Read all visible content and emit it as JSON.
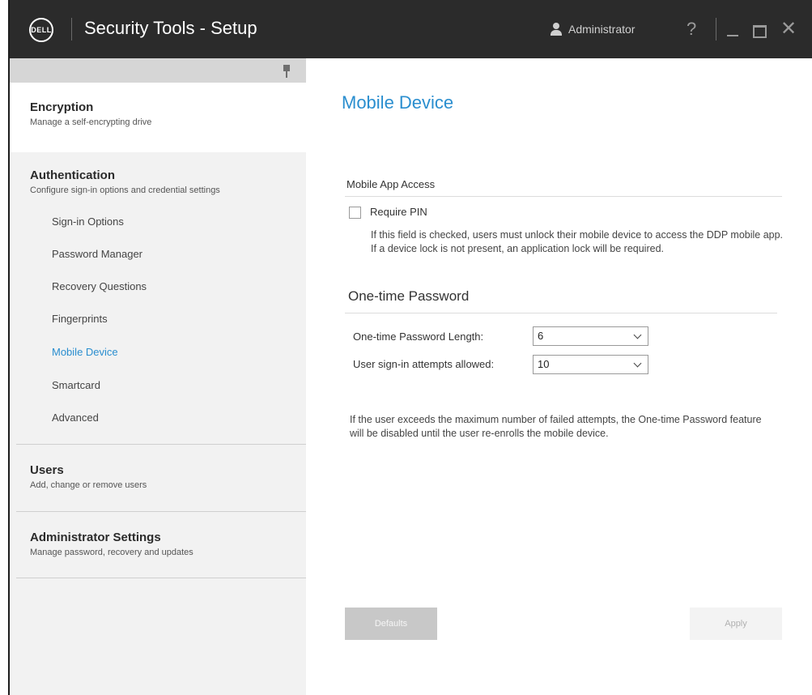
{
  "titlebar": {
    "logo_text": "DELL",
    "app_title": "Security Tools - Setup",
    "user_label": "Administrator",
    "help_glyph": "?",
    "close_glyph": "✕"
  },
  "sidebar": {
    "sections": [
      {
        "title": "Encryption",
        "subtitle": "Manage a self-encrypting drive"
      },
      {
        "title": "Authentication",
        "subtitle": "Configure sign-in options and credential settings"
      },
      {
        "title": "Users",
        "subtitle": "Add, change or remove users"
      },
      {
        "title": "Administrator Settings",
        "subtitle": "Manage password, recovery and updates"
      }
    ],
    "auth_items": [
      {
        "label": "Sign-in Options"
      },
      {
        "label": "Password Manager"
      },
      {
        "label": "Recovery Questions"
      },
      {
        "label": "Fingerprints"
      },
      {
        "label": "Mobile Device",
        "selected": true
      },
      {
        "label": "Smartcard"
      },
      {
        "label": "Advanced"
      }
    ]
  },
  "main": {
    "page_title": "Mobile Device",
    "mobile_app_access": {
      "label": "Mobile App Access",
      "require_pin_label": "Require PIN",
      "require_pin_checked": false,
      "help": "If this field is checked, users must unlock their mobile device to access the DDP mobile app. If a device lock is not present, an application lock will be required."
    },
    "otp": {
      "header": "One-time Password",
      "length_label": "One-time Password Length:",
      "length_value": "6",
      "attempts_label": "User sign-in attempts allowed:",
      "attempts_value": "10",
      "note": "If the user exceeds the maximum number of failed attempts, the One-time Password feature will be disabled until the user re-enrolls the mobile device."
    },
    "buttons": {
      "defaults_label": "Defaults",
      "apply_label": "Apply"
    }
  },
  "colors": {
    "titlebar_bg": "#2b2b2b",
    "accent": "#2a8ecf",
    "sidebar_bg": "#f2f2f2"
  }
}
